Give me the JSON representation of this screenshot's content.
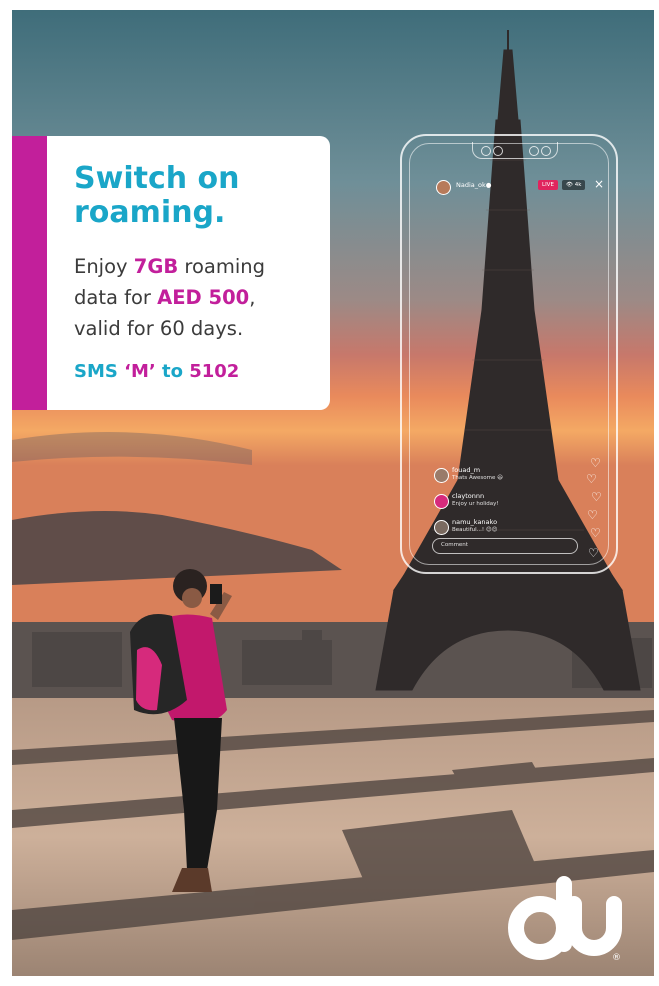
{
  "ad": {
    "headline_line1": "Switch on",
    "headline_line2": "roaming.",
    "body": {
      "enjoy": "Enjoy ",
      "data_amount": "7GB",
      "roaming": " roaming",
      "data_for": "data for ",
      "price": "AED 500",
      "comma": ",",
      "validity": "valid for 60 days."
    },
    "sms": {
      "prefix": "SMS ",
      "keyword": "‘M’",
      "to": " to ",
      "number": "5102"
    }
  },
  "phone": {
    "username": "Nadia_ok●",
    "live_badge": "LIVE",
    "viewers": "👁 4k",
    "close_icon": "×",
    "comments": [
      {
        "user": "fouad_m",
        "text": "Thats Awesome 😃"
      },
      {
        "user": "claytonnn",
        "text": "Enjoy ur holiday!"
      },
      {
        "user": "namu_kanako",
        "text": "Beautiful...! 😊😊"
      }
    ],
    "comment_placeholder": "Comment",
    "heart_glyph": "♡"
  },
  "brand": {
    "logo_text": "du",
    "registered": "®"
  },
  "colors": {
    "brand_magenta": "#c21f9b",
    "brand_cyan": "#1aa6c8"
  }
}
